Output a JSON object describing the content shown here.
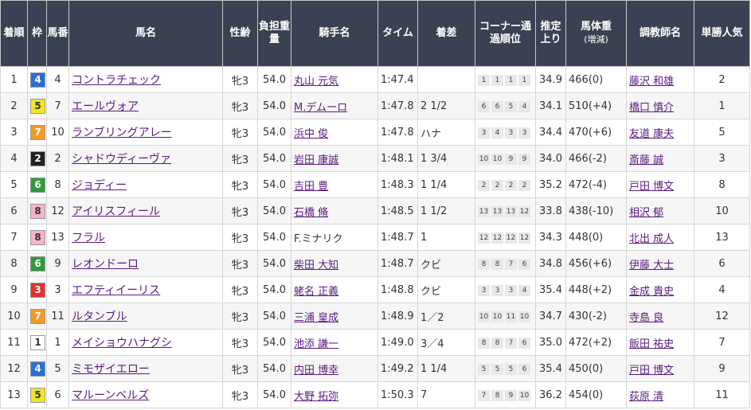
{
  "headers": {
    "rank": "着順",
    "waku": "枠",
    "umaban": "馬番",
    "horse": "馬名",
    "sexage": "性齢",
    "weight_carried": "負担重量",
    "jockey": "騎手名",
    "time": "タイム",
    "margin": "着差",
    "corner": "コーナー通過順位",
    "last3f": "推定上り",
    "body_weight": "馬体重",
    "body_weight_sub": "(増減)",
    "trainer": "調教師名",
    "popularity": "単勝人気"
  },
  "waku_colors": {
    "1": {
      "bg": "#ffffff",
      "fg": "#333333"
    },
    "2": {
      "bg": "#222222",
      "fg": "#ffffff"
    },
    "3": {
      "bg": "#e23030",
      "fg": "#ffffff"
    },
    "4": {
      "bg": "#2a6fd6",
      "fg": "#ffffff"
    },
    "5": {
      "bg": "#f2e420",
      "fg": "#333333"
    },
    "6": {
      "bg": "#2f9b3c",
      "fg": "#ffffff"
    },
    "7": {
      "bg": "#f29a26",
      "fg": "#ffffff"
    },
    "8": {
      "bg": "#f7b3c6",
      "fg": "#333333"
    }
  },
  "rows": [
    {
      "rank": "1",
      "waku": "4",
      "umaban": "4",
      "horse": "コントラチェック",
      "sexage": "牝3",
      "weight": "54.0",
      "jockey": "丸山 元気",
      "jockey_link": true,
      "time": "1:47.4",
      "margin": "",
      "corner": [
        "1",
        "1",
        "1",
        "1"
      ],
      "last3f": "34.9",
      "body_weight": "466(0)",
      "trainer": "藤沢 和雄",
      "pop": "2"
    },
    {
      "rank": "2",
      "waku": "5",
      "umaban": "7",
      "horse": "エールヴォア",
      "sexage": "牝3",
      "weight": "54.0",
      "jockey": "M.デムーロ",
      "jockey_link": true,
      "time": "1:47.8",
      "margin": "2 1/2",
      "corner": [
        "6",
        "6",
        "5",
        "4"
      ],
      "last3f": "34.1",
      "body_weight": "510(+4)",
      "trainer": "橋口 慎介",
      "pop": "1"
    },
    {
      "rank": "3",
      "waku": "7",
      "umaban": "10",
      "horse": "ランブリングアレー",
      "sexage": "牝3",
      "weight": "54.0",
      "jockey": "浜中 俊",
      "jockey_link": true,
      "time": "1:47.8",
      "margin": "ハナ",
      "corner": [
        "3",
        "4",
        "3",
        "3"
      ],
      "last3f": "34.4",
      "body_weight": "470(+6)",
      "trainer": "友道 康夫",
      "pop": "5"
    },
    {
      "rank": "4",
      "waku": "2",
      "umaban": "2",
      "horse": "シャドウディーヴァ",
      "sexage": "牝3",
      "weight": "54.0",
      "jockey": "岩田 康誠",
      "jockey_link": true,
      "time": "1:48.1",
      "margin": "1 3/4",
      "corner": [
        "10",
        "10",
        "9",
        "9"
      ],
      "last3f": "34.0",
      "body_weight": "466(-2)",
      "trainer": "斎藤 誠",
      "pop": "3"
    },
    {
      "rank": "5",
      "waku": "6",
      "umaban": "8",
      "horse": "ジョディー",
      "sexage": "牝3",
      "weight": "54.0",
      "jockey": "吉田 豊",
      "jockey_link": true,
      "time": "1:48.3",
      "margin": "1 1/4",
      "corner": [
        "2",
        "2",
        "2",
        "2"
      ],
      "last3f": "35.2",
      "body_weight": "472(-4)",
      "trainer": "戸田 博文",
      "pop": "8"
    },
    {
      "rank": "6",
      "waku": "8",
      "umaban": "12",
      "horse": "アイリスフィール",
      "sexage": "牝3",
      "weight": "54.0",
      "jockey": "石橋 脩",
      "jockey_link": true,
      "time": "1:48.5",
      "margin": "1 1/2",
      "corner": [
        "13",
        "13",
        "13",
        "12"
      ],
      "last3f": "33.8",
      "body_weight": "438(-10)",
      "trainer": "相沢 郁",
      "pop": "10"
    },
    {
      "rank": "7",
      "waku": "8",
      "umaban": "13",
      "horse": "フラル",
      "sexage": "牝3",
      "weight": "54.0",
      "jockey": "F.ミナリク",
      "jockey_link": false,
      "time": "1:48.7",
      "margin": "1",
      "corner": [
        "12",
        "12",
        "12",
        "12"
      ],
      "last3f": "34.3",
      "body_weight": "448(0)",
      "trainer": "北出 成人",
      "pop": "13"
    },
    {
      "rank": "8",
      "waku": "6",
      "umaban": "9",
      "horse": "レオンドーロ",
      "sexage": "牝3",
      "weight": "54.0",
      "jockey": "柴田 大知",
      "jockey_link": true,
      "time": "1:48.7",
      "margin": "クビ",
      "corner": [
        "8",
        "8",
        "7",
        "6"
      ],
      "last3f": "34.8",
      "body_weight": "456(+6)",
      "trainer": "伊藤 大士",
      "pop": "6"
    },
    {
      "rank": "9",
      "waku": "3",
      "umaban": "3",
      "horse": "エフティイーリス",
      "sexage": "牝3",
      "weight": "54.0",
      "jockey": "蛯名 正義",
      "jockey_link": true,
      "time": "1:48.8",
      "margin": "クビ",
      "corner": [
        "3",
        "3",
        "3",
        "4"
      ],
      "last3f": "35.4",
      "body_weight": "448(+2)",
      "trainer": "金成 貴史",
      "pop": "4"
    },
    {
      "rank": "10",
      "waku": "7",
      "umaban": "11",
      "horse": "ルタンブル",
      "sexage": "牝3",
      "weight": "54.0",
      "jockey": "三浦 皇成",
      "jockey_link": true,
      "time": "1:48.9",
      "margin": "1／2",
      "corner": [
        "10",
        "10",
        "11",
        "10"
      ],
      "last3f": "34.7",
      "body_weight": "430(-2)",
      "trainer": "寺島 良",
      "pop": "12"
    },
    {
      "rank": "11",
      "waku": "1",
      "umaban": "1",
      "horse": "メイショウハナグシ",
      "sexage": "牝3",
      "weight": "54.0",
      "jockey": "池添 謙一",
      "jockey_link": true,
      "time": "1:49.0",
      "margin": "3／4",
      "corner": [
        "8",
        "8",
        "7",
        "6"
      ],
      "last3f": "35.0",
      "body_weight": "472(+2)",
      "trainer": "飯田 祐史",
      "pop": "7"
    },
    {
      "rank": "12",
      "waku": "4",
      "umaban": "5",
      "horse": "ミモザイエロー",
      "sexage": "牝3",
      "weight": "54.0",
      "jockey": "内田 博幸",
      "jockey_link": true,
      "time": "1:49.2",
      "margin": "1 1/4",
      "corner": [
        "5",
        "5",
        "5",
        "6"
      ],
      "last3f": "35.4",
      "body_weight": "450(0)",
      "trainer": "戸田 博文",
      "pop": "9"
    },
    {
      "rank": "13",
      "waku": "5",
      "umaban": "6",
      "horse": "マルーンベルズ",
      "sexage": "牝3",
      "weight": "54.0",
      "jockey": "大野 拓弥",
      "jockey_link": true,
      "time": "1:50.3",
      "margin": "7",
      "corner": [
        "7",
        "8",
        "9",
        "10"
      ],
      "last3f": "36.2",
      "body_weight": "454(0)",
      "trainer": "荻原 清",
      "pop": "11"
    }
  ]
}
